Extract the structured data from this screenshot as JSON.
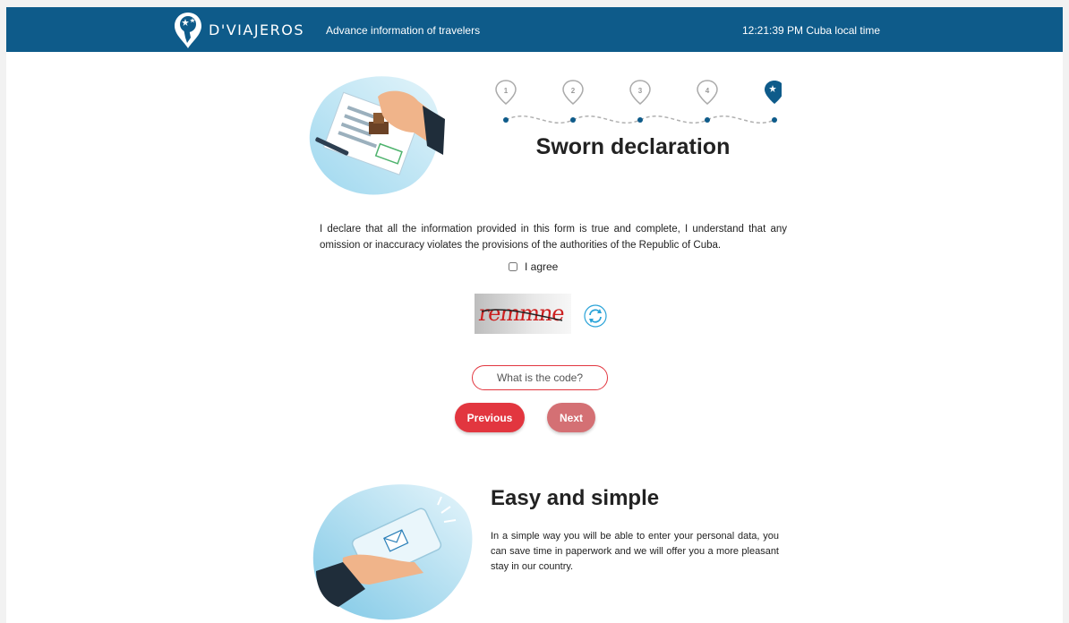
{
  "header": {
    "brand": "D'VIAJEROS",
    "tagline": "Advance information of travelers",
    "clock": "12:21:39 PM Cuba local time",
    "bg_color": "#0e5b8a"
  },
  "stepper": {
    "steps": [
      "1",
      "2",
      "3",
      "4"
    ],
    "current_step_icon": "traveler-star-icon",
    "accent_color": "#0e5b8a"
  },
  "form": {
    "title": "Sworn declaration",
    "declaration": "I declare that all the information provided in this form is true and complete, I understand that any omission or inaccuracy violates the provisions of the authorities of the Republic of Cuba.",
    "agree_label": "I agree",
    "agree_checked": false,
    "captcha_text": "remmne",
    "code_placeholder": "What is the code?",
    "code_value": "",
    "previous_label": "Previous",
    "next_label": "Next",
    "primary_color": "#e2363f"
  },
  "easy": {
    "title": "Easy and simple",
    "text": "In a simple way you will be able to enter your personal data, you can save time in paperwork and we will offer you a more pleasant stay in our country."
  }
}
